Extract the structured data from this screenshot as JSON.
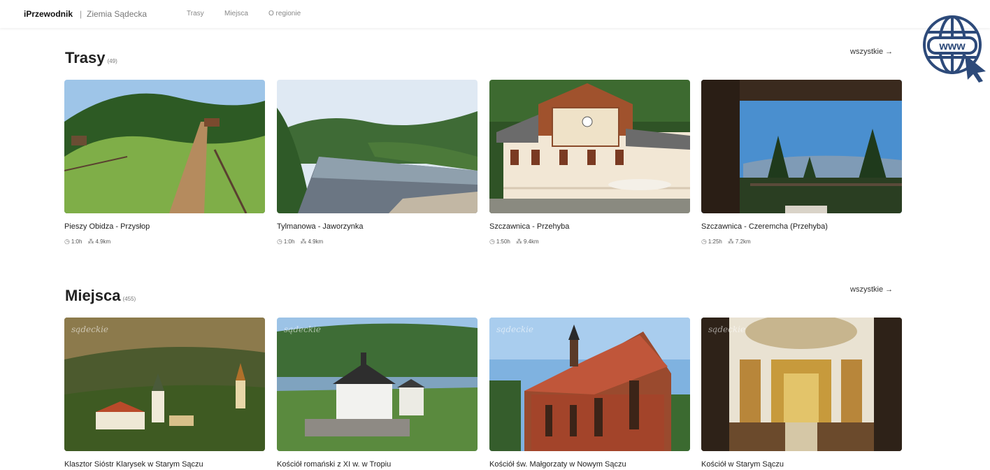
{
  "header": {
    "brand": "iPrzewodnik",
    "separator": "|",
    "region": "Ziemia Sądecka",
    "nav": [
      "Trasy",
      "Miejsca",
      "O regionie"
    ]
  },
  "www_badge": {
    "label": "www"
  },
  "trasy": {
    "title": "Trasy",
    "count": "(49)",
    "all_label": "wszystkie →",
    "cards": [
      {
        "title": "Pieszy Obidza - Przysłop",
        "time": "1:0h",
        "distance": "4.9km"
      },
      {
        "title": "Tylmanowa - Jaworzynka",
        "time": "1:0h",
        "distance": "4.9km"
      },
      {
        "title": "Szczawnica - Przehyba",
        "time": "1:50h",
        "distance": "9.4km"
      },
      {
        "title": "Szczawnica - Czeremcha (Przehyba)",
        "time": "1:25h",
        "distance": "7.2km"
      }
    ]
  },
  "miejsca": {
    "title": "Miejsca",
    "count": "(455)",
    "all_label": "wszystkie →",
    "watermark": "sądeckie",
    "cards": [
      {
        "title": "Klasztor Sióstr Klarysek w Starym Sączu"
      },
      {
        "title": "Kościół romański z XI w. w Tropiu"
      },
      {
        "title": "Kościół św. Małgorzaty w Nowym Sączu"
      },
      {
        "title": "Kościół w Starym Sączu"
      }
    ]
  },
  "colors": {
    "accent": "#2d4a7a"
  }
}
